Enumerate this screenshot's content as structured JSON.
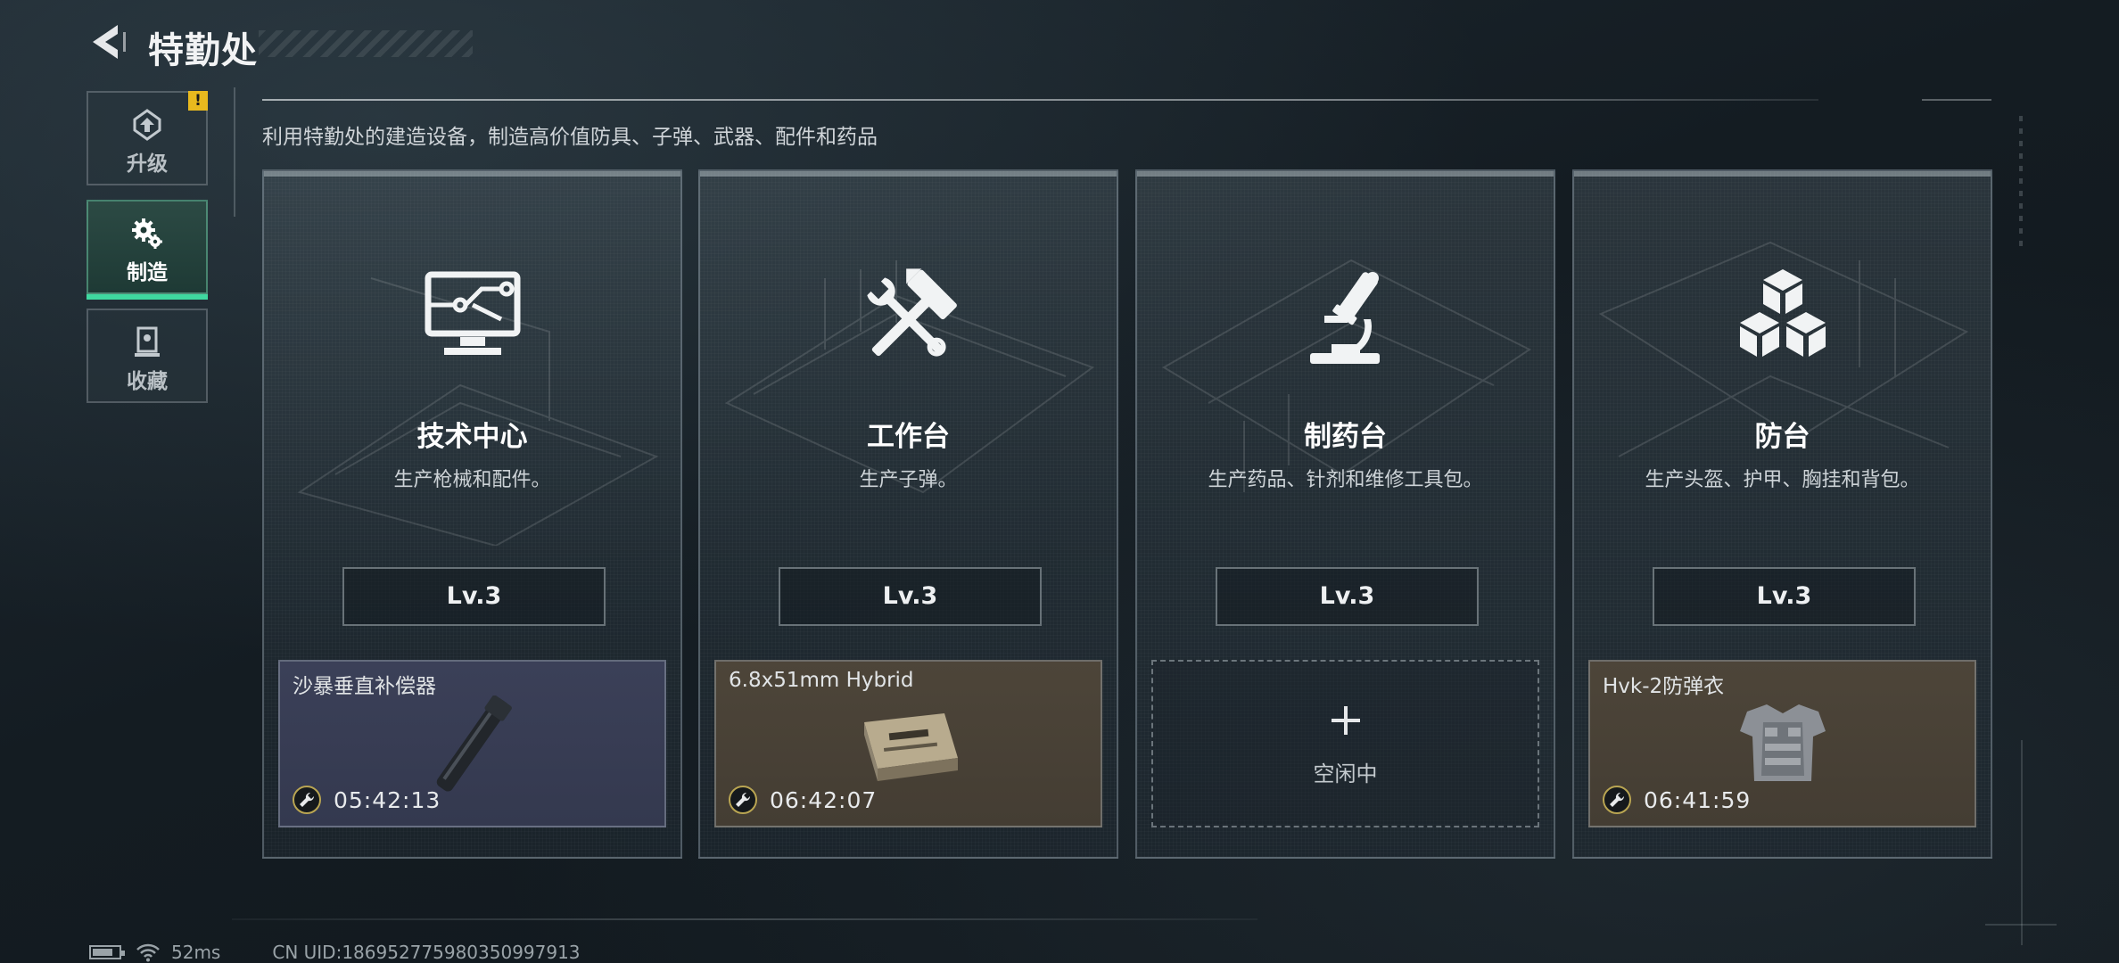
{
  "header": {
    "title": "特勤处",
    "subtitle": "利用特勤处的建造设备，制造高价值防具、子弹、武器、配件和药品"
  },
  "sidebar": {
    "items": [
      {
        "label": "升级",
        "icon": "upgrade-icon",
        "alert": "!",
        "active": false
      },
      {
        "label": "制造",
        "icon": "gear-icon",
        "active": true
      },
      {
        "label": "收藏",
        "icon": "trophy-icon",
        "active": false
      }
    ]
  },
  "stations": [
    {
      "title": "技术中心",
      "desc": "生产枪械和配件。",
      "icon": "monitor-circuit-icon",
      "level": "Lv.3",
      "slot": {
        "state": "producing",
        "item_name": "沙暴垂直补偿器",
        "timer": "05:42:13",
        "color": "#3b4058"
      }
    },
    {
      "title": "工作台",
      "desc": "生产子弹。",
      "icon": "hammer-wrench-icon",
      "level": "Lv.3",
      "slot": {
        "state": "producing",
        "item_name": "6.8x51mm Hybrid",
        "timer": "06:42:07",
        "color": "#4d4539"
      }
    },
    {
      "title": "制药台",
      "desc": "生产药品、针剂和维修工具包。",
      "icon": "microscope-icon",
      "level": "Lv.3",
      "slot": {
        "state": "idle",
        "idle_text": "空闲中"
      }
    },
    {
      "title": "防台",
      "desc": "生产头盔、护甲、胸挂和背包。",
      "icon": "cubes-icon",
      "level": "Lv.3",
      "slot": {
        "state": "producing",
        "item_name": "Hvk-2防弹衣",
        "timer": "06:41:59",
        "color": "#4d4539"
      }
    }
  ],
  "status_bar": {
    "ping": "52ms",
    "uid": "CN UID:186952775980350997913"
  },
  "colors": {
    "accent_green": "#3fd9a0",
    "alert_yellow": "#e8b91e",
    "rarity_purple": "#3b4058",
    "rarity_gold": "#4d4539"
  }
}
